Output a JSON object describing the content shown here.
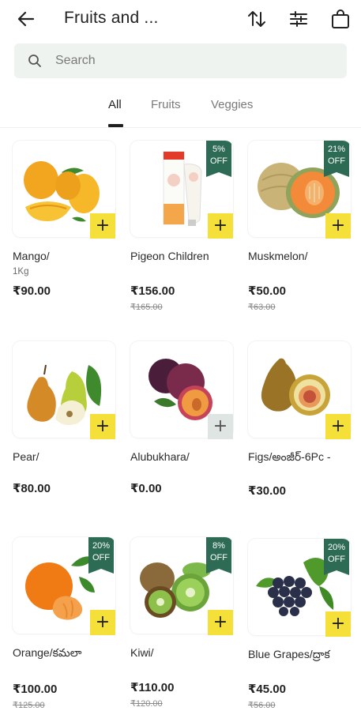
{
  "header": {
    "title": "Fruits and ...",
    "back_icon": "arrow-left-icon",
    "sort_icon": "sort-icon",
    "filter_icon": "filter-sliders-icon",
    "cart_icon": "shopping-bag-icon"
  },
  "search": {
    "placeholder": "Search"
  },
  "tabs": [
    {
      "label": "All",
      "active": true
    },
    {
      "label": "Fruits",
      "active": false
    },
    {
      "label": "Veggies",
      "active": false
    }
  ],
  "products": [
    {
      "name": "Mango/",
      "sub": "1Kg",
      "price": "₹90.00",
      "mrp": "",
      "badge": [],
      "add": "+",
      "add_enabled": true,
      "image": "mango"
    },
    {
      "name": "Pigeon Children",
      "sub": "",
      "price": "₹156.00",
      "mrp": "₹165.00",
      "badge": [
        "5%",
        "OFF"
      ],
      "add": "+",
      "add_enabled": true,
      "image": "toothpaste"
    },
    {
      "name": "Muskmelon/",
      "sub": "",
      "price": "₹50.00",
      "mrp": "₹63.00",
      "badge": [
        "21%",
        "OFF"
      ],
      "add": "+",
      "add_enabled": true,
      "image": "muskmelon"
    },
    {
      "name": "Pear/",
      "sub": "",
      "price": "₹80.00",
      "mrp": "",
      "badge": [],
      "add": "+",
      "add_enabled": true,
      "image": "pear"
    },
    {
      "name": "Alubukhara/",
      "sub": "",
      "price": "₹0.00",
      "mrp": "",
      "badge": [],
      "add": "+",
      "add_enabled": false,
      "image": "plum"
    },
    {
      "name": "Figs/అంజీర్-6Pc -",
      "sub": "",
      "price": "₹30.00",
      "mrp": "",
      "badge": [],
      "add": "+",
      "add_enabled": true,
      "image": "fig"
    },
    {
      "name": "Orange/కమలా",
      "sub": "",
      "price": "₹100.00",
      "mrp": "₹125.00",
      "badge": [
        "20%",
        "OFF"
      ],
      "add": "+",
      "add_enabled": true,
      "image": "orange"
    },
    {
      "name": "Kiwi/",
      "sub": "",
      "price": "₹110.00",
      "mrp": "₹120.00",
      "badge": [
        "8%",
        "OFF"
      ],
      "add": "+",
      "add_enabled": true,
      "image": "kiwi"
    },
    {
      "name": "Blue Grapes/ద్రాక",
      "sub": "",
      "price": "₹45.00",
      "mrp": "₹56.00",
      "badge": [
        "20%",
        "OFF"
      ],
      "add": "+",
      "add_enabled": true,
      "image": "grapes"
    }
  ]
}
